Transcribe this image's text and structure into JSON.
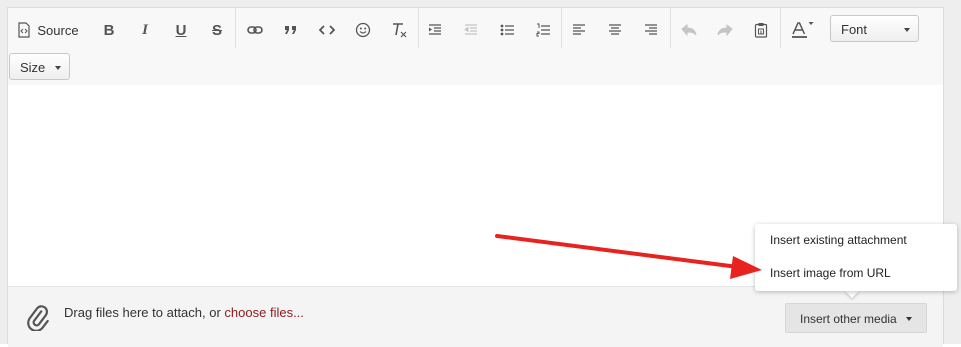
{
  "toolbar": {
    "source_label": "Source",
    "bold_letter": "B",
    "italic_letter": "I",
    "underline_letter": "U",
    "strike_letter": "S",
    "font_label": "Font",
    "size_label": "Size"
  },
  "icons": [
    "source-icon",
    "bold-icon",
    "italic-icon",
    "underline-icon",
    "strikethrough-icon",
    "link-icon",
    "quote-icon",
    "code-icon",
    "smiley-icon",
    "clear-format-icon",
    "indent-icon",
    "outdent-icon",
    "bullet-list-icon",
    "numbered-list-icon",
    "align-left-icon",
    "align-center-icon",
    "align-right-icon",
    "undo-icon",
    "redo-icon",
    "paste-icon",
    "text-color-icon",
    "paperclip-icon"
  ],
  "attach": {
    "text": "Drag files here to attach, or ",
    "link": "choose files...",
    "media_button": "Insert other media"
  },
  "menu": {
    "items": [
      "Insert existing attachment",
      "Insert image from URL"
    ]
  },
  "colors": {
    "link": "#8b1c1c",
    "annotation_arrow": "#e8231f"
  }
}
